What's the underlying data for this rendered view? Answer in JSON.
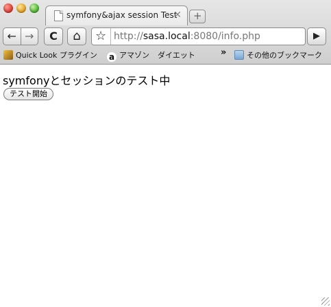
{
  "window": {
    "tab_title": "symfony&ajax session Test",
    "tab_close_glyph": "✕",
    "new_tab_glyph": "+"
  },
  "toolbar": {
    "back_icon": "←",
    "forward_icon": "→",
    "reload_icon": "C",
    "home_icon": "⌂",
    "star_icon": "☆",
    "url_scheme": "http://",
    "url_host": "sasa.local",
    "url_rest": ":8080/info.php",
    "go_icon": "▶"
  },
  "bookmarks": {
    "items": [
      {
        "label": "Quick Look プラグイン",
        "icon": "quicklook-icon"
      },
      {
        "label": "アマゾン",
        "icon": "amazon-icon"
      },
      {
        "label": "ダイエット",
        "icon": "none"
      }
    ],
    "overflow_glyph": "»",
    "other_bookmarks": "その他のブックマーク"
  },
  "page": {
    "heading": "symfonyとセッションのテスト中",
    "start_button": "テスト開始"
  }
}
